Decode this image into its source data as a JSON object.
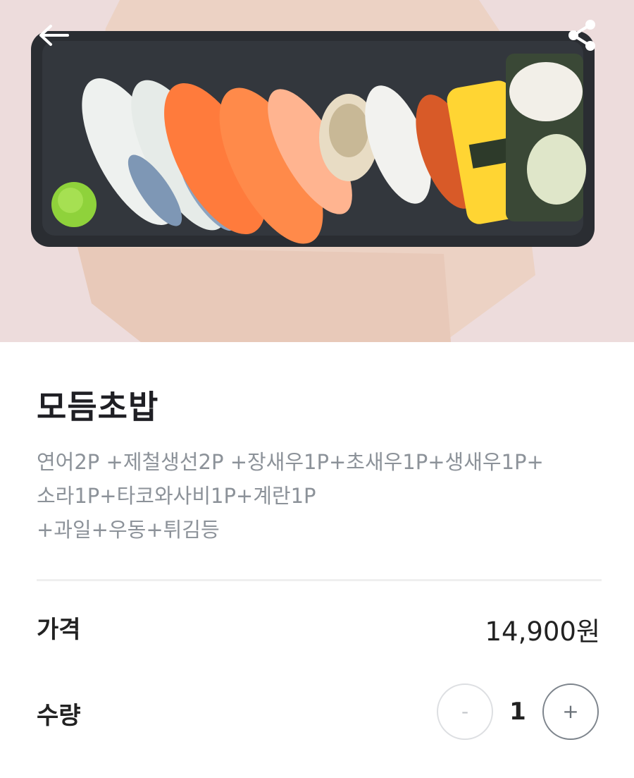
{
  "header": {
    "back_icon": "arrow-left-icon",
    "share_icon": "share-icon"
  },
  "product": {
    "image": "sushi-plate-photo",
    "title": "모듬초밥",
    "description_lines": [
      "연어2P +제철생선2P +장새우1P+초새우1P+생새우1P+",
      "소라1P+타코와사비1P+계란1P",
      "+과일+우동+튀김등"
    ]
  },
  "price": {
    "label": "가격",
    "value": "14,900원"
  },
  "quantity": {
    "label": "수량",
    "minus_label": "-",
    "value": "1",
    "plus_label": "+"
  }
}
